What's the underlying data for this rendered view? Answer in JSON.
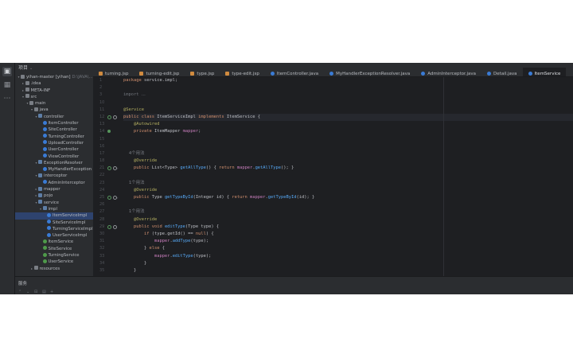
{
  "tools": [
    "folder-icon",
    "structure-icon",
    "more-icon"
  ],
  "project": {
    "header": "项目",
    "tree": [
      {
        "text": "yihan-master [yihan]",
        "suffix": "D:\\JAVA\\...",
        "depth": 0,
        "icon": "folder",
        "twisty": "v"
      },
      {
        "text": ".idea",
        "depth": 1,
        "icon": "folder",
        "twisty": ">"
      },
      {
        "text": "META-INF",
        "depth": 1,
        "icon": "folder",
        "twisty": ">"
      },
      {
        "text": "src",
        "depth": 1,
        "icon": "folder",
        "twisty": "v"
      },
      {
        "text": "main",
        "depth": 2,
        "icon": "folder",
        "twisty": "v"
      },
      {
        "text": "java",
        "depth": 3,
        "icon": "folder",
        "twisty": "v"
      },
      {
        "text": "controller",
        "depth": 4,
        "icon": "pkg",
        "twisty": "v"
      },
      {
        "text": "ItemController",
        "depth": 5,
        "icon": "cls",
        "twisty": ""
      },
      {
        "text": "SiteController",
        "depth": 5,
        "icon": "cls",
        "twisty": ""
      },
      {
        "text": "TurningController",
        "depth": 5,
        "icon": "cls",
        "twisty": ""
      },
      {
        "text": "UploadController",
        "depth": 5,
        "icon": "cls",
        "twisty": ""
      },
      {
        "text": "UserController",
        "depth": 5,
        "icon": "cls",
        "twisty": ""
      },
      {
        "text": "ViewController",
        "depth": 5,
        "icon": "cls",
        "twisty": ""
      },
      {
        "text": "ExceptionResolver",
        "depth": 4,
        "icon": "pkg",
        "twisty": "v"
      },
      {
        "text": "MyHandlerException",
        "depth": 5,
        "icon": "cls",
        "twisty": ""
      },
      {
        "text": "interceptor",
        "depth": 4,
        "icon": "pkg",
        "twisty": "v"
      },
      {
        "text": "AdminInterceptor",
        "depth": 5,
        "icon": "cls",
        "twisty": ""
      },
      {
        "text": "mapper",
        "depth": 4,
        "icon": "pkg",
        "twisty": ">"
      },
      {
        "text": "pojo",
        "depth": 4,
        "icon": "pkg",
        "twisty": ">"
      },
      {
        "text": "service",
        "depth": 4,
        "icon": "pkg",
        "twisty": "v"
      },
      {
        "text": "impl",
        "depth": 5,
        "icon": "pkg",
        "twisty": "v"
      },
      {
        "text": "ItemServiceImpl",
        "depth": 6,
        "icon": "cls",
        "twisty": "",
        "selected": true
      },
      {
        "text": "SiteServiceImpl",
        "depth": 6,
        "icon": "cls",
        "twisty": ""
      },
      {
        "text": "TurningServiceImpl",
        "depth": 6,
        "icon": "cls",
        "twisty": ""
      },
      {
        "text": "UserServiceImpl",
        "depth": 6,
        "icon": "cls",
        "twisty": ""
      },
      {
        "text": "ItemService",
        "depth": 5,
        "icon": "iface",
        "twisty": ""
      },
      {
        "text": "SiteService",
        "depth": 5,
        "icon": "iface",
        "twisty": ""
      },
      {
        "text": "TurningService",
        "depth": 5,
        "icon": "iface",
        "twisty": ""
      },
      {
        "text": "UserService",
        "depth": 5,
        "icon": "iface",
        "twisty": ""
      },
      {
        "text": "resources",
        "depth": 3,
        "icon": "folder",
        "twisty": ">"
      }
    ]
  },
  "tabs": [
    {
      "label": "turning.jsp",
      "kind": "jsp"
    },
    {
      "label": "turning-edit.jsp",
      "kind": "jsp"
    },
    {
      "label": "type.jsp",
      "kind": "jsp"
    },
    {
      "label": "type-edit.jsp",
      "kind": "jsp"
    },
    {
      "label": "ItemController.java",
      "kind": "java"
    },
    {
      "label": "MyHandlerExceptionResolver.java",
      "kind": "java"
    },
    {
      "label": "AdminInterceptor.java",
      "kind": "java"
    },
    {
      "label": "Detail.java",
      "kind": "java"
    },
    {
      "label": "ItemService",
      "kind": "java",
      "active": true
    }
  ],
  "gutter": [
    {
      "n": "1"
    },
    {
      "n": "2"
    },
    {
      "n": "3"
    },
    {
      "n": "10"
    },
    {
      "n": "11"
    },
    {
      "n": "12",
      "icons": [
        "run",
        "ovr"
      ]
    },
    {
      "n": "13"
    },
    {
      "n": "14",
      "icons": [
        "bean"
      ]
    },
    {
      "n": "15"
    },
    {
      "n": "16"
    },
    {
      "n": "17"
    },
    {
      "n": "18"
    },
    {
      "n": "21",
      "icons": [
        "run",
        "ovr",
        "fold"
      ]
    },
    {
      "n": "22"
    },
    {
      "n": "23"
    },
    {
      "n": "24"
    },
    {
      "n": "25",
      "icons": [
        "run",
        "ovr",
        "fold"
      ]
    },
    {
      "n": "26"
    },
    {
      "n": "27"
    },
    {
      "n": "28"
    },
    {
      "n": "29",
      "icons": [
        "run",
        "ovr"
      ]
    },
    {
      "n": "30"
    },
    {
      "n": "31"
    },
    {
      "n": "32"
    },
    {
      "n": "33"
    },
    {
      "n": "34"
    },
    {
      "n": "35"
    }
  ],
  "code": [
    [
      [
        "kw",
        "package "
      ],
      [
        "ty",
        "service.impl;"
      ]
    ],
    [],
    [
      [
        "hint",
        "import "
      ],
      [
        "cm",
        "..."
      ]
    ],
    [],
    [
      [
        "ann",
        "@Service"
      ]
    ],
    [
      [
        "kw",
        "public class "
      ],
      [
        "ty",
        "ItemServiceImpl "
      ],
      [
        "kw",
        "implements "
      ],
      [
        "ty",
        "ItemService {"
      ]
    ],
    [
      [
        "ty",
        "    "
      ],
      [
        "ann",
        "@Autowired"
      ]
    ],
    [
      [
        "ty",
        "    "
      ],
      [
        "kw",
        "private "
      ],
      [
        "ty",
        "ItemMapper "
      ],
      [
        "fld",
        "mapper"
      ],
      [
        "ty",
        ";"
      ]
    ],
    [],
    [],
    [
      [
        "cm",
        "    4个用法"
      ]
    ],
    [
      [
        "ty",
        "    "
      ],
      [
        "ann",
        "@Override"
      ]
    ],
    [
      [
        "ty",
        "    "
      ],
      [
        "kw",
        "public "
      ],
      [
        "ty",
        "List<Type> "
      ],
      [
        "fn",
        "getAllType"
      ],
      [
        "ty",
        "() { "
      ],
      [
        "kw",
        "return "
      ],
      [
        "fld",
        "mapper"
      ],
      [
        "ty",
        "."
      ],
      [
        "fn",
        "getAllType"
      ],
      [
        "ty",
        "(); }"
      ]
    ],
    [],
    [
      [
        "cm",
        "    1个用法"
      ]
    ],
    [
      [
        "ty",
        "    "
      ],
      [
        "ann",
        "@Override"
      ]
    ],
    [
      [
        "ty",
        "    "
      ],
      [
        "kw",
        "public "
      ],
      [
        "ty",
        "Type "
      ],
      [
        "fn",
        "getTypeById"
      ],
      [
        "ty",
        "(Integer id) { "
      ],
      [
        "kw",
        "return "
      ],
      [
        "fld",
        "mapper"
      ],
      [
        "ty",
        "."
      ],
      [
        "fn",
        "getTypeById"
      ],
      [
        "ty",
        "(id); }"
      ]
    ],
    [],
    [
      [
        "cm",
        "    1个用法"
      ]
    ],
    [
      [
        "ty",
        "    "
      ],
      [
        "ann",
        "@Override"
      ]
    ],
    [
      [
        "ty",
        "    "
      ],
      [
        "kw",
        "public void "
      ],
      [
        "fn",
        "editType"
      ],
      [
        "ty",
        "(Type type) {"
      ]
    ],
    [
      [
        "ty",
        "        "
      ],
      [
        "kw",
        "if "
      ],
      [
        "ty",
        "(type.getId() == "
      ],
      [
        "kw",
        "null"
      ],
      [
        "ty",
        ") {"
      ]
    ],
    [
      [
        "ty",
        "            "
      ],
      [
        "fld",
        "mapper"
      ],
      [
        "ty",
        "."
      ],
      [
        "fn",
        "addType"
      ],
      [
        "ty",
        "(type);"
      ]
    ],
    [
      [
        "ty",
        "        } "
      ],
      [
        "kw",
        "else "
      ],
      [
        "ty",
        "{"
      ]
    ],
    [
      [
        "ty",
        "            "
      ],
      [
        "fld",
        "mapper"
      ],
      [
        "ty",
        "."
      ],
      [
        "fn",
        "editType"
      ],
      [
        "ty",
        "(type);"
      ]
    ],
    [
      [
        "ty",
        "        }"
      ]
    ],
    [
      [
        "ty",
        "    }"
      ]
    ]
  ],
  "bottom": {
    "label": "服务"
  }
}
